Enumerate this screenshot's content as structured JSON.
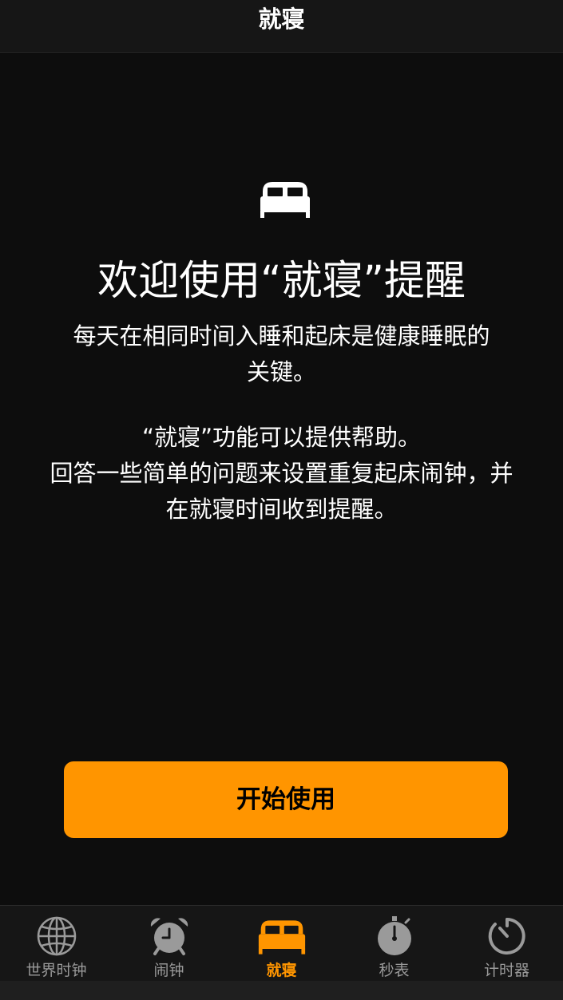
{
  "nav": {
    "title": "就寝"
  },
  "hero": {
    "icon": "bed-icon",
    "title": "欢迎使用“就寝”提醒",
    "paragraph1": [
      "每天在相同时间入睡和起床是健康睡眠的",
      "关键。"
    ],
    "paragraph2": [
      "“就寝”功能可以提供帮助。",
      "回答一些简单的问题来设置重复起床闹钟，并",
      "在就寝时间收到提醒。"
    ]
  },
  "button": {
    "label": "开始使用",
    "color": "#ff9500"
  },
  "tabs": [
    {
      "label": "世界时钟",
      "icon": "globe-icon",
      "active": false
    },
    {
      "label": "闹钟",
      "icon": "alarm-clock-icon",
      "active": false
    },
    {
      "label": "就寝",
      "icon": "bed-icon",
      "active": true
    },
    {
      "label": "秒表",
      "icon": "stopwatch-icon",
      "active": false
    },
    {
      "label": "计时器",
      "icon": "timer-icon",
      "active": false
    }
  ],
  "colors": {
    "accent": "#ff9500",
    "background": "#0d0d0d",
    "inactive_tab": "#9a9a9a"
  }
}
